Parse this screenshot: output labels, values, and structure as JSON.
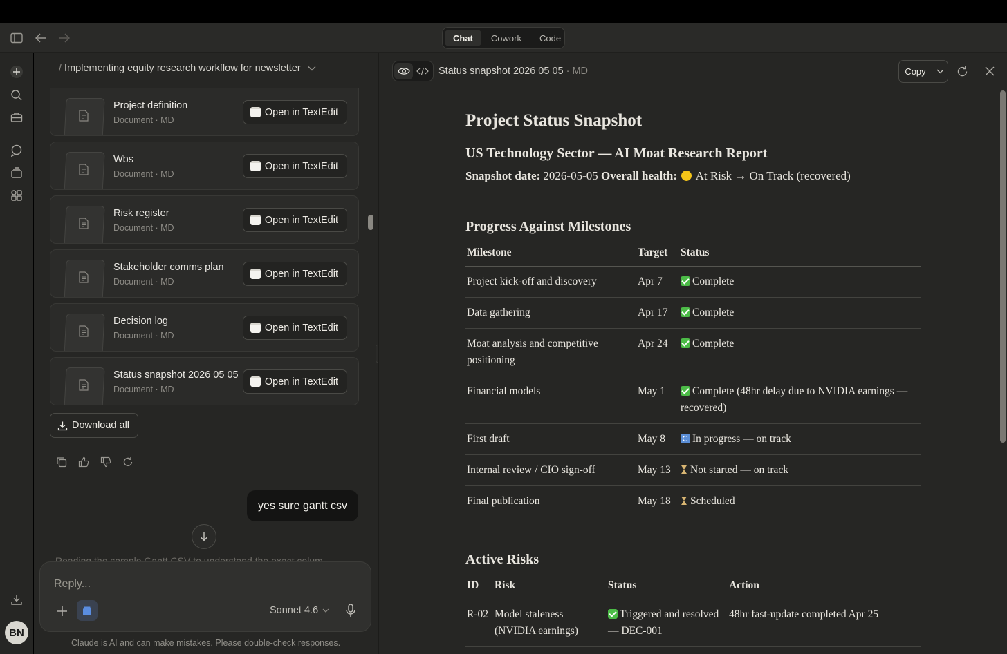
{
  "app": {
    "modes": [
      "Chat",
      "Cowork",
      "Code"
    ],
    "active_mode": "Chat",
    "avatar_initials": "BN"
  },
  "chat": {
    "title_prefix": "/",
    "title": "Implementing equity research workflow for newsletter",
    "files": [
      {
        "name": "Project definition",
        "meta": "Document · MD",
        "action": "Open in TextEdit"
      },
      {
        "name": "Wbs",
        "meta": "Document · MD",
        "action": "Open in TextEdit"
      },
      {
        "name": "Risk register",
        "meta": "Document · MD",
        "action": "Open in TextEdit"
      },
      {
        "name": "Stakeholder comms plan",
        "meta": "Document · MD",
        "action": "Open in TextEdit"
      },
      {
        "name": "Decision log",
        "meta": "Document · MD",
        "action": "Open in TextEdit"
      },
      {
        "name": "Status snapshot 2026 05 05",
        "meta": "Document · MD",
        "action": "Open in TextEdit"
      }
    ],
    "download_all": "Download all",
    "user_message": "yes sure gantt csv",
    "faded_text": "Reading the sample Gantt CSV to understand the exact colum...",
    "reply_placeholder": "Reply...",
    "model": "Sonnet 4.6",
    "disclaimer": "Claude is AI and can make mistakes. Please double-check responses."
  },
  "panel": {
    "file_title": "Status snapshot 2026 05 05",
    "file_meta": " · MD",
    "copy_label": "Copy",
    "doc": {
      "h1": "Project Status Snapshot",
      "h2": "US Technology Sector — AI Moat Research Report",
      "snapshot_label": "Snapshot date:",
      "snapshot_date": " 2026-05-05 ",
      "health_label": "Overall health:",
      "health_value": " At Risk → On Track (recovered)",
      "milestones_heading": "Progress Against Milestones",
      "milestone_headers": [
        "Milestone",
        "Target",
        "Status"
      ],
      "milestones": [
        {
          "milestone": "Project kick-off and discovery",
          "target": "Apr 7",
          "icon": "check",
          "status": "Complete"
        },
        {
          "milestone": "Data gathering",
          "target": "Apr 17",
          "icon": "check",
          "status": "Complete"
        },
        {
          "milestone": "Moat analysis and competitive positioning",
          "target": "Apr 24",
          "icon": "check",
          "status": "Complete"
        },
        {
          "milestone": "Financial models",
          "target": "May 1",
          "icon": "check",
          "status": "Complete (48hr delay due to NVIDIA earnings — recovered)"
        },
        {
          "milestone": "First draft",
          "target": "May 8",
          "icon": "progress",
          "status": "In progress — on track"
        },
        {
          "milestone": "Internal review / CIO sign-off",
          "target": "May 13",
          "icon": "hourglass",
          "status": "Not started — on track"
        },
        {
          "milestone": "Final publication",
          "target": "May 18",
          "icon": "hourglass",
          "status": "Scheduled"
        }
      ],
      "risks_heading": "Active Risks",
      "risk_headers": [
        "ID",
        "Risk",
        "Status",
        "Action"
      ],
      "risks": [
        {
          "id": "R-02",
          "risk": "Model staleness (NVIDIA earnings)",
          "icon": "check",
          "status": "Triggered and resolved — DEC-001",
          "action": "48hr fast-update completed Apr 25"
        }
      ]
    }
  },
  "colors": {
    "background": "#262624",
    "check_green": "#4cbb47",
    "progress_blue": "#5b8ed6",
    "health_yellow": "#f5c518"
  }
}
